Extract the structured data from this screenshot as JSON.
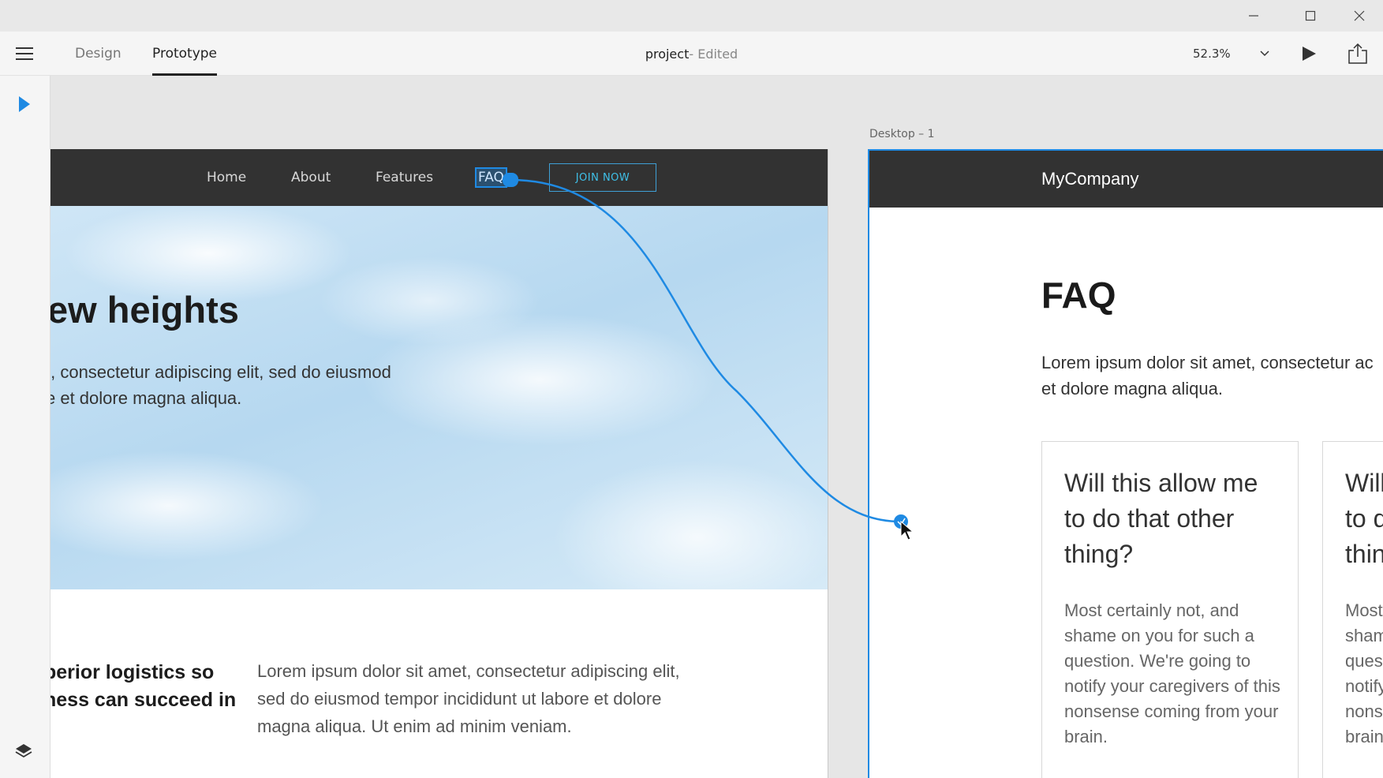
{
  "window": {
    "minimize_glyph": "—",
    "maximize_glyph": "☐",
    "close_glyph": "✕"
  },
  "appbar": {
    "tabs": [
      {
        "label": "Design"
      },
      {
        "label": "Prototype"
      }
    ],
    "doc_name": "project",
    "doc_status": " - Edited",
    "zoom": "52.3%"
  },
  "artboard_home": {
    "nav": [
      "Home",
      "About",
      "Features",
      "FAQ"
    ],
    "join_label": "JOIN NOW",
    "hero_title": "ew heights",
    "hero_text_line1": "t, consectetur adipiscing elit, sed do eiusmod",
    "hero_text_line2": "e et dolore magna aliqua.",
    "feature_title_line1": "perior logistics so",
    "feature_title_line2": "ness can succeed in",
    "feature_text": "Lorem ipsum dolor sit amet, consectetur adipiscing elit, sed do eiusmod tempor incididunt ut labore et dolore magna aliqua. Ut enim ad minim veniam."
  },
  "artboard_faq": {
    "label": "Desktop – 1",
    "brand": "MyCompany",
    "heading": "FAQ",
    "intro_line1": "Lorem ipsum dolor sit amet, consectetur ac",
    "intro_line2": "et dolore magna aliqua.",
    "cards": [
      {
        "question": "Will this allow me to do that other thing?",
        "answer": "Most certainly not, and shame on you for such a question. We're going to notify your caregivers of this nonsense coming from your brain."
      },
      {
        "question": "Will this allow me to do that other thing?",
        "answer": "Most certainly not, and shame on you for such a question. We're going to notify your caregivers of this nonsense coming from your brain."
      }
    ]
  },
  "colors": {
    "accent": "#1f8ae3",
    "nav_bg": "#323232",
    "join": "#3fc0e8"
  }
}
